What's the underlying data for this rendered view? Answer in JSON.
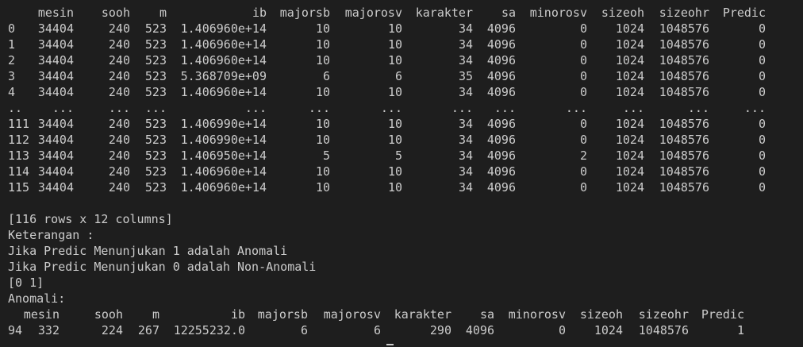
{
  "terminal": {
    "background": "#1e1e1e",
    "foreground": "#cccccc"
  },
  "df_table": {
    "headers": [
      "",
      "mesin",
      "sooh",
      "m",
      "ib",
      "majorsb",
      "majorosv",
      "karakter",
      "sa",
      "minorosv",
      "sizeoh",
      "sizeohr",
      "Predic"
    ],
    "rows": [
      [
        "0",
        "34404",
        "240",
        "523",
        "1.406960e+14",
        "10",
        "10",
        "34",
        "4096",
        "0",
        "1024",
        "1048576",
        "0"
      ],
      [
        "1",
        "34404",
        "240",
        "523",
        "1.406960e+14",
        "10",
        "10",
        "34",
        "4096",
        "0",
        "1024",
        "1048576",
        "0"
      ],
      [
        "2",
        "34404",
        "240",
        "523",
        "1.406960e+14",
        "10",
        "10",
        "34",
        "4096",
        "0",
        "1024",
        "1048576",
        "0"
      ],
      [
        "3",
        "34404",
        "240",
        "523",
        "5.368709e+09",
        "6",
        "6",
        "35",
        "4096",
        "0",
        "1024",
        "1048576",
        "0"
      ],
      [
        "4",
        "34404",
        "240",
        "523",
        "1.406960e+14",
        "10",
        "10",
        "34",
        "4096",
        "0",
        "1024",
        "1048576",
        "0"
      ],
      [
        "..",
        "...",
        "...",
        "...",
        "...",
        "...",
        "...",
        "...",
        "...",
        "...",
        "...",
        "...",
        "..."
      ],
      [
        "111",
        "34404",
        "240",
        "523",
        "1.406990e+14",
        "10",
        "10",
        "34",
        "4096",
        "0",
        "1024",
        "1048576",
        "0"
      ],
      [
        "112",
        "34404",
        "240",
        "523",
        "1.406990e+14",
        "10",
        "10",
        "34",
        "4096",
        "0",
        "1024",
        "1048576",
        "0"
      ],
      [
        "113",
        "34404",
        "240",
        "523",
        "1.406950e+14",
        "5",
        "5",
        "34",
        "4096",
        "2",
        "1024",
        "1048576",
        "0"
      ],
      [
        "114",
        "34404",
        "240",
        "523",
        "1.406960e+14",
        "10",
        "10",
        "34",
        "4096",
        "0",
        "1024",
        "1048576",
        "0"
      ],
      [
        "115",
        "34404",
        "240",
        "523",
        "1.406960e+14",
        "10",
        "10",
        "34",
        "4096",
        "0",
        "1024",
        "1048576",
        "0"
      ]
    ]
  },
  "output_lines": [
    "",
    "[116 rows x 12 columns]",
    "Keterangan :",
    "Jika Predic Menunjukan 1 adalah Anomali",
    "Jika Predic Menunjukan 0 adalah Non-Anomali",
    "[0 1]",
    "Anomali:"
  ],
  "anomaly_table": {
    "headers": [
      "",
      "mesin",
      "sooh",
      "m",
      "ib",
      "majorsb",
      "majorosv",
      "karakter",
      "sa",
      "minorosv",
      "sizeoh",
      "sizeohr",
      "Predic"
    ],
    "rows": [
      [
        "94",
        "332",
        "224",
        "267",
        "12255232.0",
        "6",
        "6",
        "290",
        "4096",
        "0",
        "1024",
        "1048576",
        "1"
      ]
    ]
  }
}
